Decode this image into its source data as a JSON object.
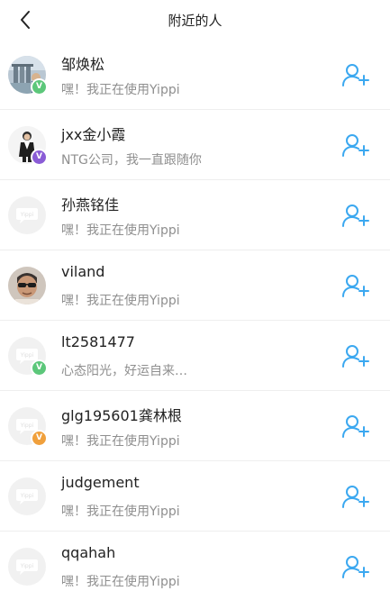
{
  "header": {
    "title": "附近的人"
  },
  "colors": {
    "accent": "#3ba8f0",
    "badge_green": "#5cc77a",
    "badge_purple": "#8a5cd6",
    "badge_orange": "#f0a03c"
  },
  "people": [
    {
      "name": "邹焕松",
      "status": "嘿！我正在使用Yippi",
      "avatar": "photo-city",
      "badge": "green"
    },
    {
      "name": "jxx金小霞",
      "status": "NTG公司，我一直跟随你",
      "avatar": "photo-woman",
      "badge": "purple"
    },
    {
      "name": "孙燕铭佳",
      "status": "嘿！我正在使用Yippi",
      "avatar": "placeholder",
      "badge": ""
    },
    {
      "name": "viland",
      "status": "嘿！我正在使用Yippi",
      "avatar": "photo-man",
      "badge": ""
    },
    {
      "name": "lt2581477",
      "status": "心态阳光，好运自来…",
      "avatar": "placeholder",
      "badge": "green"
    },
    {
      "name": "glg195601龚林根",
      "status": "嘿！我正在使用Yippi",
      "avatar": "placeholder",
      "badge": "orange"
    },
    {
      "name": "judgement",
      "status": "嘿！我正在使用Yippi",
      "avatar": "placeholder",
      "badge": ""
    },
    {
      "name": "qqahah",
      "status": "嘿！我正在使用Yippi",
      "avatar": "placeholder",
      "badge": ""
    }
  ],
  "badge_letter": "V",
  "placeholder_logo": "Yippi"
}
